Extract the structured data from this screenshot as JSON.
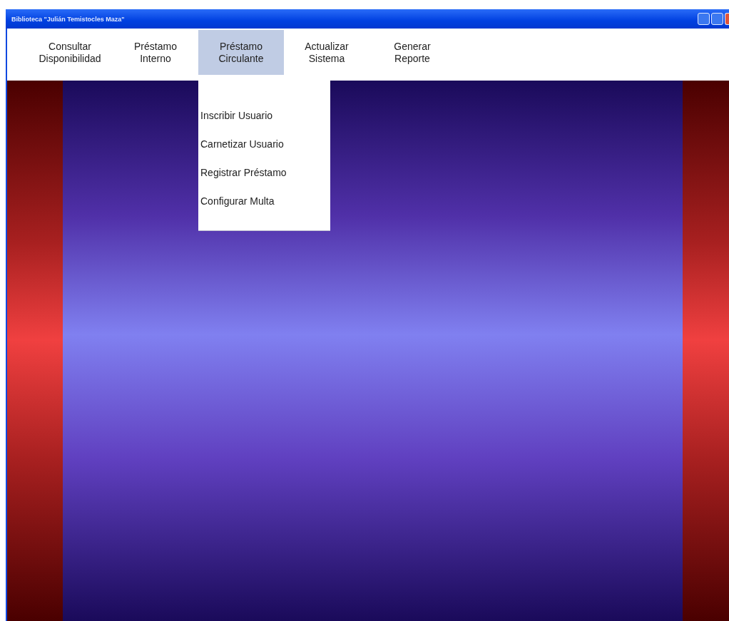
{
  "window": {
    "title": "Biblioteca \"Julián Temistocles Maza\""
  },
  "menu": [
    {
      "label": "Consultar Disponibilidad",
      "selected": false
    },
    {
      "label": "Préstamo Interno",
      "selected": false
    },
    {
      "label": "Préstamo Circulante",
      "selected": true,
      "submenu": [
        "Inscribir Usuario",
        "Carnetizar Usuario",
        "Registrar Préstamo",
        "Configurar Multa"
      ]
    },
    {
      "label": "Actualizar Sistema",
      "selected": false
    },
    {
      "label": "Generar Reporte",
      "selected": false
    }
  ]
}
